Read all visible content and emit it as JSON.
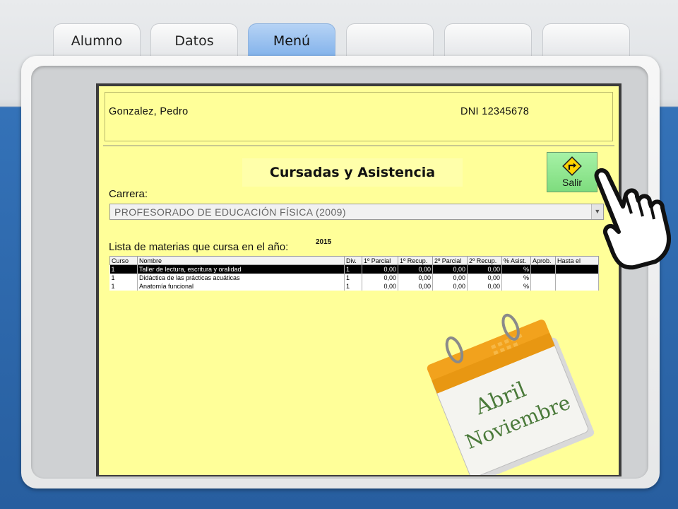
{
  "tabs": [
    {
      "label": "Alumno"
    },
    {
      "label": "Datos"
    },
    {
      "label": "Menú"
    },
    {
      "label": ""
    },
    {
      "label": ""
    },
    {
      "label": ""
    }
  ],
  "student": {
    "name": "Gonzalez, Pedro",
    "dni": "DNI  12345678"
  },
  "section_title": "Cursadas y Asistencia",
  "exit_button": {
    "label": "Salir",
    "icon": "turn-right-sign-icon"
  },
  "career": {
    "label": "Carrera:",
    "value": "PROFESORADO DE EDUCACIÓN FÍSICA (2009)"
  },
  "subjects": {
    "label": "Lista de materias que cursa en el año:",
    "year": "2015",
    "columns": [
      "Curso",
      "Nombre",
      "Div.",
      "1º Parcial",
      "1º Recup.",
      "2º Parcial",
      "2º Recup.",
      "% Asist.",
      "Aprob.",
      "Hasta el"
    ],
    "rows": [
      [
        "1",
        "Taller de lectura, escritura y oralidad",
        "1",
        "0,00",
        "0,00",
        "0,00",
        "0,00",
        "%",
        "",
        ""
      ],
      [
        "1",
        "Didáctica de las prácticas acuáticas",
        "1",
        "0,00",
        "0,00",
        "0,00",
        "0,00",
        "%",
        "",
        ""
      ],
      [
        "1",
        "Anatomía funcional",
        "1",
        "0,00",
        "0,00",
        "0,00",
        "0,00",
        "%",
        "",
        ""
      ]
    ]
  },
  "calendar": {
    "line1": "Abril",
    "line2": "Noviembre"
  },
  "colors": {
    "window_bg": "#ffff99",
    "active_tab": "#8fbaf0",
    "exit_button": "#8ee38e",
    "selected_row": "#000000"
  }
}
